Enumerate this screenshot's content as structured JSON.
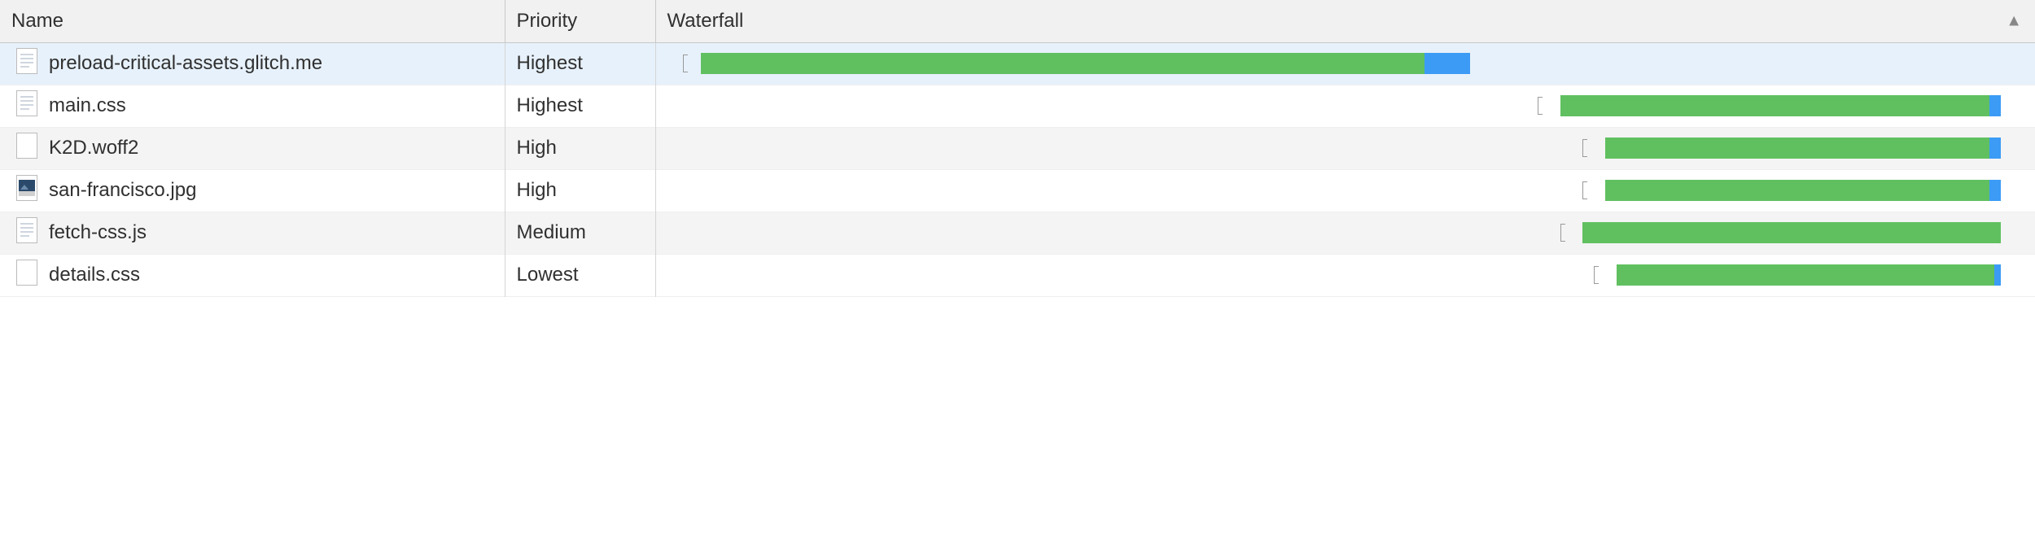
{
  "columns": {
    "name": "Name",
    "priority": "Priority",
    "waterfall": "Waterfall"
  },
  "sort": {
    "column": "waterfall",
    "dir": "asc"
  },
  "rows": [
    {
      "name": "preload-critical-assets.glitch.me",
      "priority": "Highest",
      "icon": "document",
      "selected": true,
      "waterfall": {
        "tick": 0.7,
        "start": 1.5,
        "end": 33.5,
        "tail": 35.5
      }
    },
    {
      "name": "main.css",
      "priority": "Highest",
      "icon": "document",
      "selected": false,
      "waterfall": {
        "tick": 38.5,
        "start": 39.5,
        "end": 58.5,
        "tail": 59.0
      }
    },
    {
      "name": "K2D.woff2",
      "priority": "High",
      "icon": "blank",
      "selected": false,
      "waterfall": {
        "tick": 40.5,
        "start": 41.5,
        "end": 58.5,
        "tail": 59.0
      }
    },
    {
      "name": "san-francisco.jpg",
      "priority": "High",
      "icon": "image",
      "selected": false,
      "waterfall": {
        "tick": 40.5,
        "start": 41.5,
        "end": 58.5,
        "tail": 59.0
      }
    },
    {
      "name": "fetch-css.js",
      "priority": "Medium",
      "icon": "document",
      "selected": false,
      "waterfall": {
        "tick": 39.5,
        "start": 40.5,
        "end": 59.0,
        "tail": 59.0
      }
    },
    {
      "name": "details.css",
      "priority": "Lowest",
      "icon": "blank",
      "selected": false,
      "waterfall": {
        "tick": 41.0,
        "start": 42.0,
        "end": 58.7,
        "tail": 59.0
      }
    }
  ],
  "waterfall_scale": 60
}
